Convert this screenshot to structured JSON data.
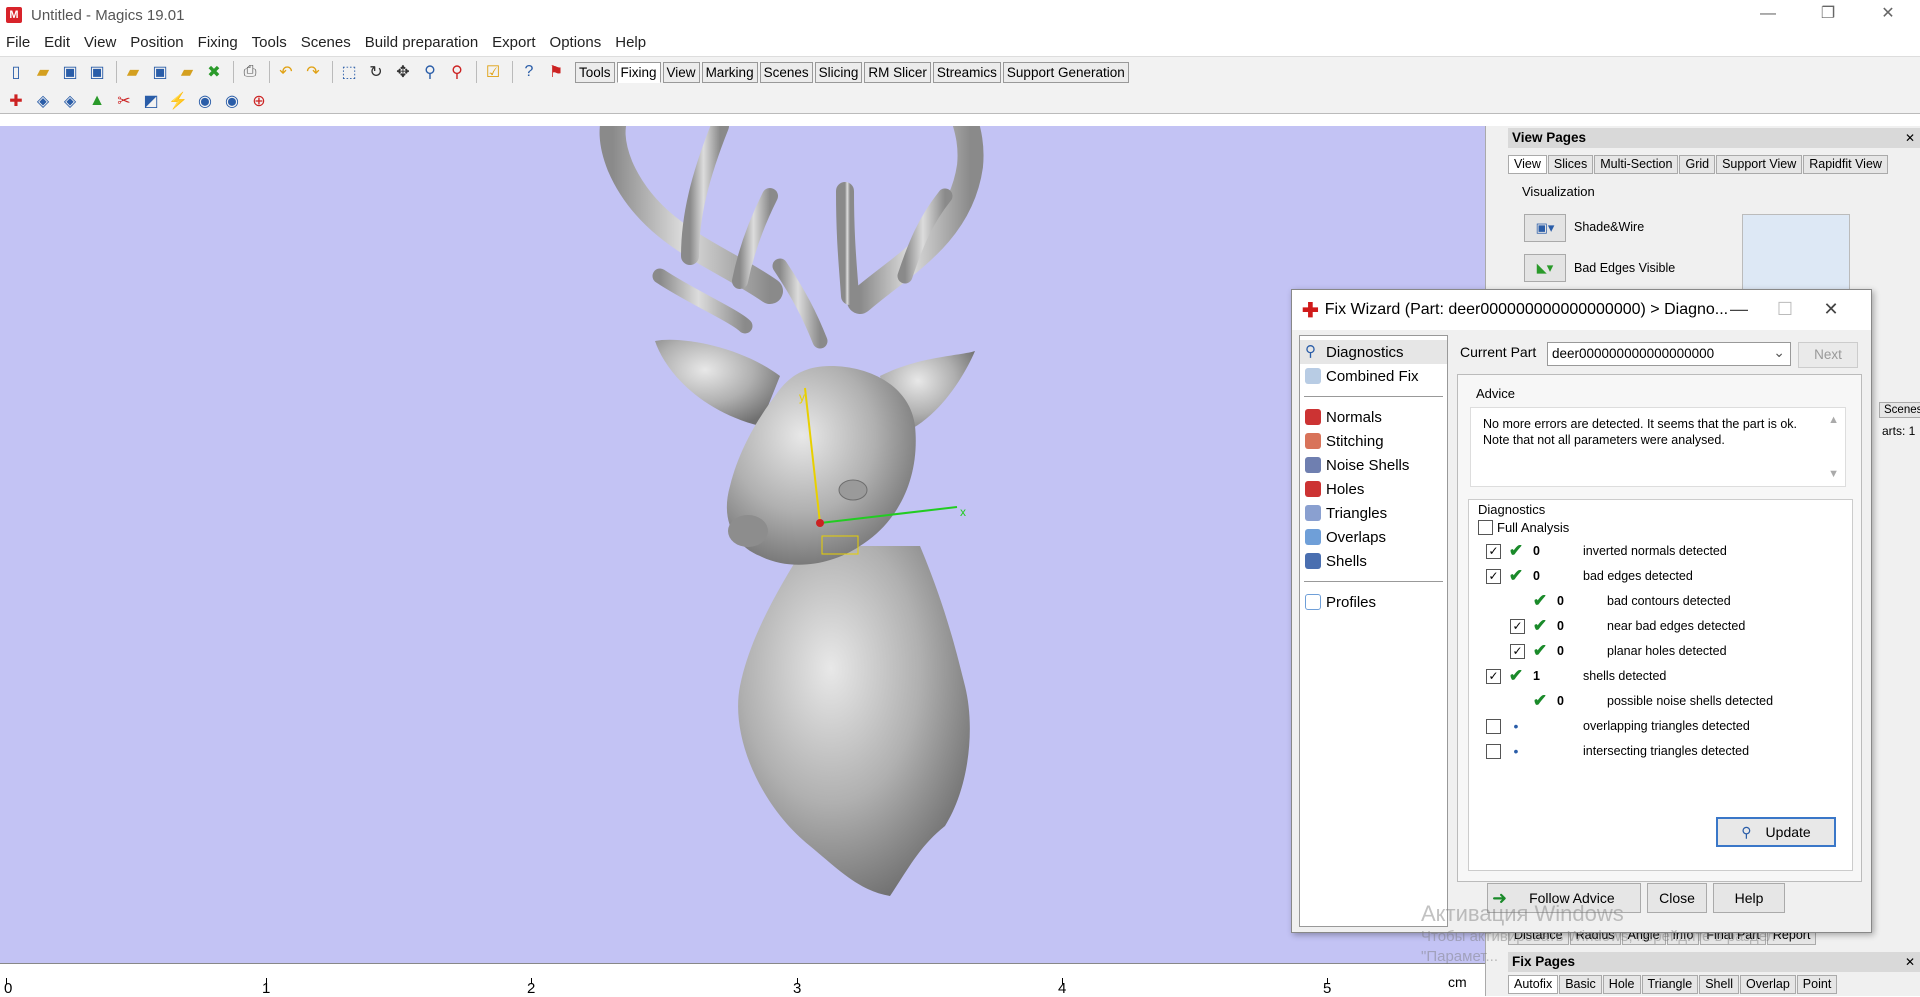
{
  "window": {
    "title": "Untitled - Magics 19.01",
    "minimize": "—",
    "restore": "❐",
    "close": "✕"
  },
  "menu": [
    "File",
    "Edit",
    "View",
    "Position",
    "Fixing",
    "Tools",
    "Scenes",
    "Build preparation",
    "Export",
    "Options",
    "Help"
  ],
  "toolbar": {
    "tabs": [
      "Tools",
      "Fixing",
      "View",
      "Marking",
      "Scenes",
      "Slicing",
      "RM Slicer",
      "Streamics",
      "Support Generation"
    ],
    "active_tab": "Fixing"
  },
  "ruler": {
    "labels": [
      "0",
      "1",
      "2",
      "3",
      "4",
      "5"
    ],
    "unit": "cm"
  },
  "view_pages": {
    "title": "View Pages",
    "tabs": [
      "View",
      "Slices",
      "Multi-Section",
      "Grid",
      "Support View",
      "Rapidfit View"
    ],
    "active_tab": "View",
    "visualization_label": "Visualization",
    "items": [
      "Shade&Wire",
      "Bad Edges Visible"
    ]
  },
  "right_partial": {
    "scenes_tab": "Scenes",
    "parts_label": "arts: 1"
  },
  "measure_tabs": [
    "Distance",
    "Radius",
    "Angle",
    "Info",
    "Final Part",
    "Report"
  ],
  "fix_pages": {
    "title": "Fix Pages",
    "tabs": [
      "Autofix",
      "Basic",
      "Hole",
      "Triangle",
      "Shell",
      "Overlap",
      "Point"
    ]
  },
  "fix_wizard": {
    "title": "Fix Wizard (Part: deer000000000000000000) > Diagno...",
    "nav_top": [
      "Diagnostics",
      "Combined Fix"
    ],
    "nav_mid": [
      "Normals",
      "Stitching",
      "Noise Shells",
      "Holes",
      "Triangles",
      "Overlaps",
      "Shells"
    ],
    "nav_bottom": [
      "Profiles"
    ],
    "current_part_label": "Current Part",
    "current_part_value": "deer000000000000000000",
    "next_label": "Next",
    "advice_label": "Advice",
    "advice_text": "No more errors are detected. It seems that the part is ok. Note that not all parameters were analysed.",
    "diagnostics_label": "Diagnostics",
    "full_analysis_label": "Full Analysis",
    "rows": [
      {
        "checkbox": true,
        "checked": true,
        "status": "check",
        "count": "0",
        "label": "inverted normals detected",
        "indent": 0
      },
      {
        "checkbox": true,
        "checked": true,
        "status": "check",
        "count": "0",
        "label": "bad edges detected",
        "indent": 0
      },
      {
        "checkbox": false,
        "checked": false,
        "status": "check",
        "count": "0",
        "label": "bad contours detected",
        "indent": 1
      },
      {
        "checkbox": true,
        "checked": true,
        "status": "check",
        "count": "0",
        "label": "near bad edges detected",
        "indent": 1
      },
      {
        "checkbox": true,
        "checked": true,
        "status": "check",
        "count": "0",
        "label": "planar holes detected",
        "indent": 1
      },
      {
        "checkbox": true,
        "checked": true,
        "status": "check",
        "count": "1",
        "label": "shells detected",
        "indent": 0
      },
      {
        "checkbox": false,
        "checked": false,
        "status": "check",
        "count": "0",
        "label": "possible noise shells detected",
        "indent": 1
      },
      {
        "checkbox": true,
        "checked": false,
        "status": "dot",
        "count": "",
        "label": "overlapping triangles detected",
        "indent": 0
      },
      {
        "checkbox": true,
        "checked": false,
        "status": "dot",
        "count": "",
        "label": "intersecting triangles detected",
        "indent": 0
      }
    ],
    "update_label": "Update",
    "follow_advice_label": "Follow Advice",
    "close_label": "Close",
    "help_label": "Help"
  },
  "watermark": {
    "line1": "Активация Windows",
    "line2": "Чтобы активировать Windows, перейдите в раздел",
    "line3": "\"Парамет..."
  },
  "colors": {
    "viewport_bg": "#c3c3f4",
    "model": "#b8b8b8",
    "axis_y": "#e8d000",
    "axis_x": "#22cc22"
  }
}
